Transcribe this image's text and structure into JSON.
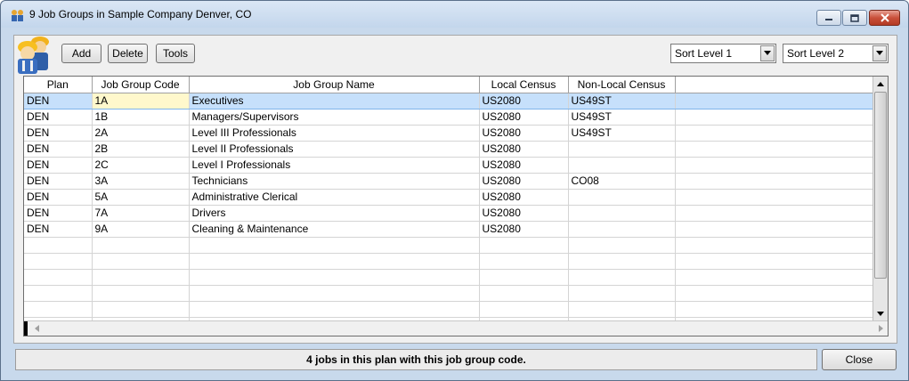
{
  "window": {
    "title": "9 Job Groups in Sample Company Denver, CO",
    "icon": "people-icon"
  },
  "toolbar": {
    "add_label": "Add",
    "delete_label": "Delete",
    "tools_label": "Tools",
    "sort_level_1": "Sort Level 1",
    "sort_level_2": "Sort Level 2"
  },
  "grid": {
    "columns": [
      "Plan",
      "Job Group Code",
      "Job Group Name",
      "Local Census",
      "Non-Local Census"
    ],
    "rows": [
      {
        "plan": "DEN",
        "code": "1A",
        "name": "Executives",
        "local": "US2080",
        "nonlocal": "US49ST"
      },
      {
        "plan": "DEN",
        "code": "1B",
        "name": "Managers/Supervisors",
        "local": "US2080",
        "nonlocal": "US49ST"
      },
      {
        "plan": "DEN",
        "code": "2A",
        "name": "Level III Professionals",
        "local": "US2080",
        "nonlocal": "US49ST"
      },
      {
        "plan": "DEN",
        "code": "2B",
        "name": "Level II Professionals",
        "local": "US2080",
        "nonlocal": ""
      },
      {
        "plan": "DEN",
        "code": "2C",
        "name": "Level I Professionals",
        "local": "US2080",
        "nonlocal": ""
      },
      {
        "plan": "DEN",
        "code": "3A",
        "name": "Technicians",
        "local": "US2080",
        "nonlocal": "CO08"
      },
      {
        "plan": "DEN",
        "code": "5A",
        "name": "Administrative Clerical",
        "local": "US2080",
        "nonlocal": ""
      },
      {
        "plan": "DEN",
        "code": "7A",
        "name": "Drivers",
        "local": "US2080",
        "nonlocal": ""
      },
      {
        "plan": "DEN",
        "code": "9A",
        "name": "Cleaning & Maintenance",
        "local": "US2080",
        "nonlocal": ""
      }
    ],
    "selected_row": 0
  },
  "status": {
    "message": "4 jobs in this plan with this job group code."
  },
  "close_label": "Close",
  "colors": {
    "selection": "#c6e0fb",
    "current_cell": "#fff8cc",
    "window_frame": "#c8d9ec"
  }
}
